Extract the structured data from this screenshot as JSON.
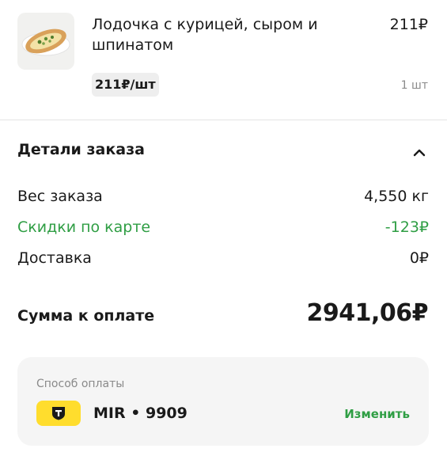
{
  "product": {
    "name": "Лодочка с курицей, сыром и шпинатом",
    "total": "211₽",
    "unit_price": "211₽/шт",
    "quantity": "1 шт",
    "image_icon": "khachapuri-food-photo"
  },
  "details": {
    "title": "Детали заказа",
    "toggle_icon": "chevron-up-icon",
    "rows": [
      {
        "label": "Вес заказа",
        "value": "4,550 кг"
      },
      {
        "label": "Скидки по карте",
        "value": "-123₽"
      },
      {
        "label": "Доставка",
        "value": "0₽"
      }
    ]
  },
  "summary": {
    "label": "Сумма к оплате",
    "value": "2941,06₽"
  },
  "payment": {
    "label": "Способ оплаты",
    "card": "MIR • 9909",
    "change_label": "Изменить",
    "bank_icon": "tbank-shield-icon"
  },
  "colors": {
    "accent_green": "#2f9e44",
    "bank_yellow": "#ffdd2d",
    "muted": "#8a8a8a"
  }
}
